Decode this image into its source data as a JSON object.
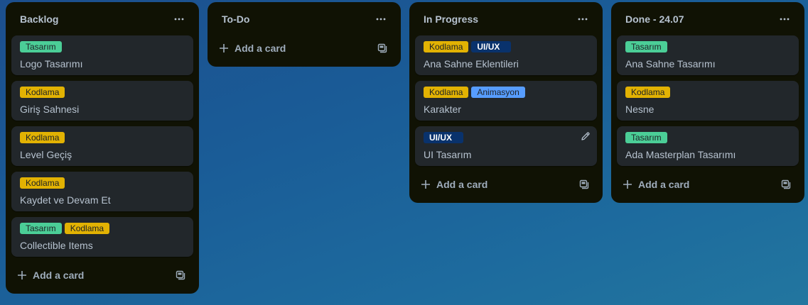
{
  "colors": {
    "list_bg": "#101204",
    "card_bg": "#22272b",
    "text": "#b6c2cf",
    "label_tasarim": "#4bce97",
    "label_kodlama": "#e2b203",
    "label_uiux": "#09326c",
    "label_animasyon": "#579dff"
  },
  "icons": {
    "list_menu": "more-horizontal-icon",
    "add": "plus-icon",
    "template": "card-template-icon",
    "edit": "pencil-icon"
  },
  "lists": [
    {
      "title": "Backlog",
      "add_label": "Add a card",
      "cards": [
        {
          "labels": [
            {
              "text": "Tasarım",
              "color": "#4bce97"
            }
          ],
          "title": "Logo Tasarımı"
        },
        {
          "labels": [
            {
              "text": "Kodlama",
              "color": "#e2b203"
            }
          ],
          "title": "Giriş Sahnesi"
        },
        {
          "labels": [
            {
              "text": "Kodlama",
              "color": "#e2b203"
            }
          ],
          "title": "Level Geçiş"
        },
        {
          "labels": [
            {
              "text": "Kodlama",
              "color": "#e2b203"
            }
          ],
          "title": "Kaydet ve Devam Et"
        },
        {
          "labels": [
            {
              "text": "Tasarım",
              "color": "#4bce97"
            },
            {
              "text": "Kodlama",
              "color": "#e2b203"
            }
          ],
          "title": "Collectible Items"
        }
      ]
    },
    {
      "title": "To-Do",
      "add_label": "Add a card",
      "cards": []
    },
    {
      "title": "In Progress",
      "add_label": "Add a card",
      "cards": [
        {
          "labels": [
            {
              "text": "Kodlama",
              "color": "#e2b203"
            },
            {
              "text": "UI/UX",
              "color": "#09326c"
            }
          ],
          "title": "Ana Sahne Eklentileri"
        },
        {
          "labels": [
            {
              "text": "Kodlama",
              "color": "#e2b203"
            },
            {
              "text": "Animasyon",
              "color": "#579dff"
            }
          ],
          "title": "Karakter"
        },
        {
          "labels": [
            {
              "text": "UI/UX",
              "color": "#09326c"
            }
          ],
          "title": "UI Tasarım",
          "hovered": true
        }
      ]
    },
    {
      "title": "Done - 24.07",
      "add_label": "Add a card",
      "cards": [
        {
          "labels": [
            {
              "text": "Tasarım",
              "color": "#4bce97"
            }
          ],
          "title": "Ana Sahne Tasarımı"
        },
        {
          "labels": [
            {
              "text": "Kodlama",
              "color": "#e2b203"
            }
          ],
          "title": "Nesne"
        },
        {
          "labels": [
            {
              "text": "Tasarım",
              "color": "#4bce97"
            }
          ],
          "title": "Ada Masterplan Tasarımı"
        }
      ]
    }
  ]
}
